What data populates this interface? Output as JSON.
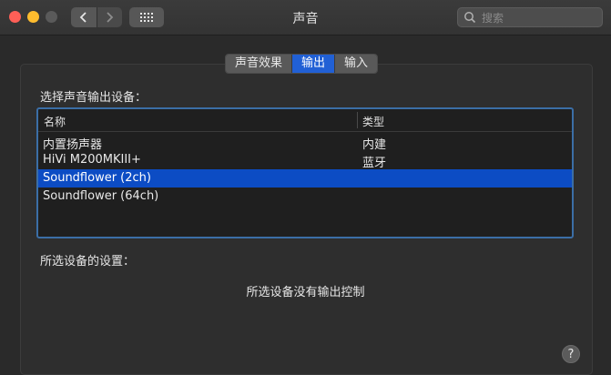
{
  "window": {
    "title": "声音"
  },
  "search": {
    "placeholder": "搜索"
  },
  "tabs": [
    {
      "label": "声音效果",
      "active": false
    },
    {
      "label": "输出",
      "active": true
    },
    {
      "label": "输入",
      "active": false
    }
  ],
  "output": {
    "select_label": "选择声音输出设备：",
    "columns": {
      "name": "名称",
      "type": "类型"
    },
    "devices": [
      {
        "name": "内置扬声器",
        "type": "内建",
        "selected": false
      },
      {
        "name": "HiVi M200MKIII+",
        "type": "蓝牙",
        "selected": false
      },
      {
        "name": "Soundflower (2ch)",
        "type": "",
        "selected": true
      },
      {
        "name": "Soundflower (64ch)",
        "type": "",
        "selected": false
      }
    ],
    "settings_label": "所选设备的设置：",
    "no_controls": "所选设备没有输出控制"
  },
  "help": {
    "label": "?"
  },
  "colors": {
    "accent": "#2160d5",
    "selection": "#0c4cc4"
  },
  "icons": [
    "back-icon",
    "forward-icon",
    "grid-icon",
    "search-icon"
  ]
}
